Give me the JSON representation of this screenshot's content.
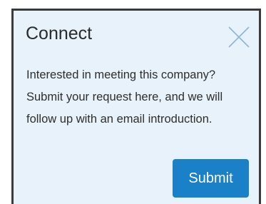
{
  "dialog": {
    "title": "Connect",
    "description": "Interested in meeting this company? Submit your request here, and we will follow up with an email introduction.",
    "submit_label": "Submit",
    "close_icon": "close-icon"
  },
  "colors": {
    "panel_background": "#e8f2fa",
    "accent": "#1a80c8",
    "icon": "#8fb3d3",
    "text": "#2e2e2e"
  }
}
